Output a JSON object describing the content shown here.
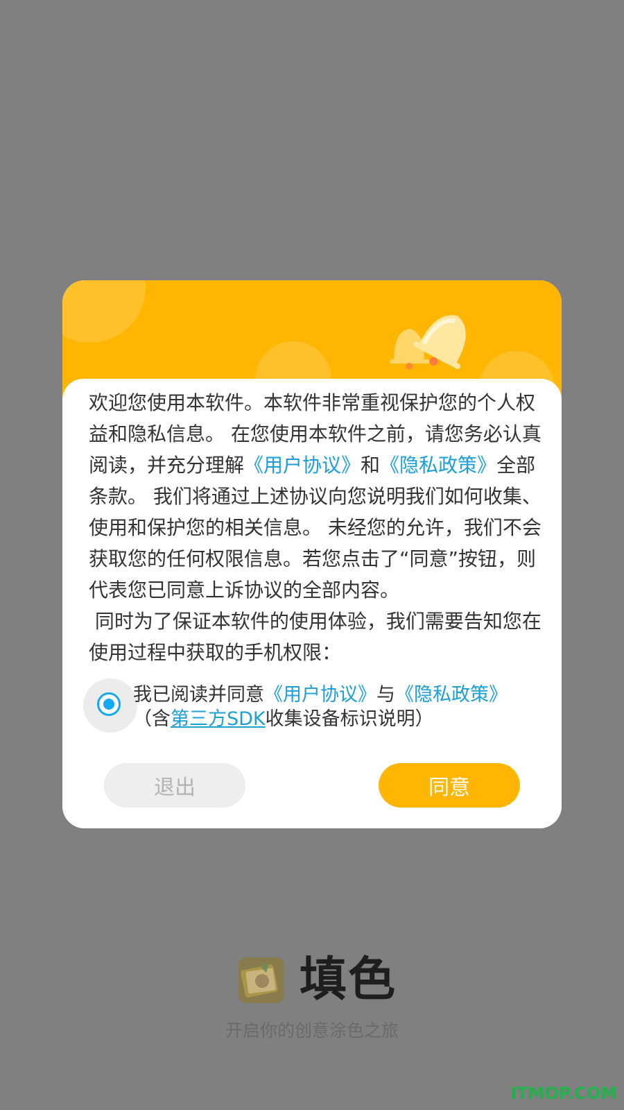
{
  "dialog": {
    "intro_p1_a": "欢迎您使用本软件。本软件非常重视保护您的个人权益和隐私信息。 在您使用本软件之前，请您务必认真阅读，并充分理解",
    "link_user_agreement": "《用户协议》",
    "and_word": "和",
    "link_privacy_policy": "《隐私政策》",
    "intro_p1_b": "全部条款。 我们将通过上述协议向您说明我们如何收集、使用和保护您的相关信息。 未经您的允许，我们不会获取您的任何权限信息。若您点击了“同意”按钮，则代表您已同意上诉协议的全部内容。",
    "intro_p2": " 同时为了保证本软件的使用体验，我们需要告知您在使用过程中获取的手机权限：",
    "consent": {
      "prefix": "我已阅读并同意",
      "link_user_agreement": "《用户协议》",
      "with_word": "与",
      "link_privacy_policy": "《隐私政策》",
      "paren_open": "（含",
      "link_sdk": "第三方SDK",
      "suffix": "收集设备标识说明）",
      "checked": true
    },
    "exit_label": "退出",
    "agree_label": "同意"
  },
  "splash": {
    "app_name": "填色",
    "slogan": "开启你的创意涂色之旅"
  },
  "watermark": "ITMOP.COM",
  "colors": {
    "accent": "#ffb602",
    "link": "#1a9fd8",
    "radio": "#12a8f2",
    "overlay": "#808080"
  }
}
